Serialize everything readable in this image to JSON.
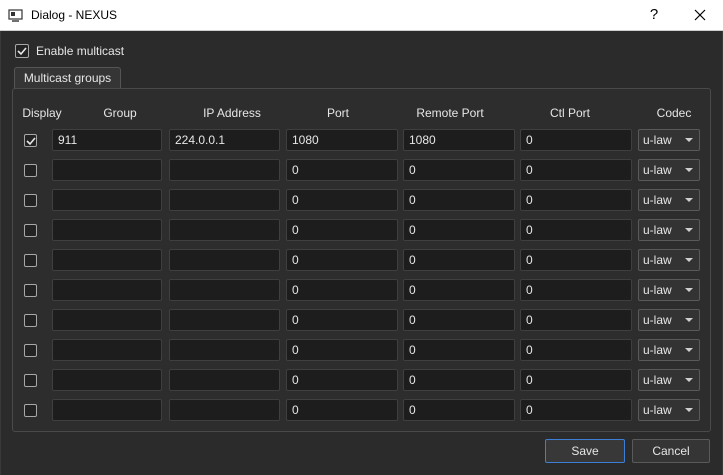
{
  "window": {
    "title": "Dialog - NEXUS",
    "help_label": "?"
  },
  "enable_multicast": {
    "label": "Enable multicast",
    "checked": true
  },
  "tab": {
    "label": "Multicast groups"
  },
  "columns": {
    "display": "Display",
    "group": "Group",
    "ip": "IP Address",
    "port": "Port",
    "remote_port": "Remote Port",
    "ctl_port": "Ctl Port",
    "codec": "Codec"
  },
  "rows": [
    {
      "display": true,
      "group": "911",
      "ip": "224.0.0.1",
      "port": "1080",
      "remote_port": "1080",
      "ctl_port": "0",
      "codec": "u-law"
    },
    {
      "display": false,
      "group": "",
      "ip": "",
      "port": "0",
      "remote_port": "0",
      "ctl_port": "0",
      "codec": "u-law"
    },
    {
      "display": false,
      "group": "",
      "ip": "",
      "port": "0",
      "remote_port": "0",
      "ctl_port": "0",
      "codec": "u-law"
    },
    {
      "display": false,
      "group": "",
      "ip": "",
      "port": "0",
      "remote_port": "0",
      "ctl_port": "0",
      "codec": "u-law"
    },
    {
      "display": false,
      "group": "",
      "ip": "",
      "port": "0",
      "remote_port": "0",
      "ctl_port": "0",
      "codec": "u-law"
    },
    {
      "display": false,
      "group": "",
      "ip": "",
      "port": "0",
      "remote_port": "0",
      "ctl_port": "0",
      "codec": "u-law"
    },
    {
      "display": false,
      "group": "",
      "ip": "",
      "port": "0",
      "remote_port": "0",
      "ctl_port": "0",
      "codec": "u-law"
    },
    {
      "display": false,
      "group": "",
      "ip": "",
      "port": "0",
      "remote_port": "0",
      "ctl_port": "0",
      "codec": "u-law"
    },
    {
      "display": false,
      "group": "",
      "ip": "",
      "port": "0",
      "remote_port": "0",
      "ctl_port": "0",
      "codec": "u-law"
    },
    {
      "display": false,
      "group": "",
      "ip": "",
      "port": "0",
      "remote_port": "0",
      "ctl_port": "0",
      "codec": "u-law"
    }
  ],
  "buttons": {
    "save": "Save",
    "cancel": "Cancel"
  },
  "colors": {
    "accent": "#3d7fd6",
    "background": "#2b2b2b",
    "field": "#1d1d1d"
  }
}
